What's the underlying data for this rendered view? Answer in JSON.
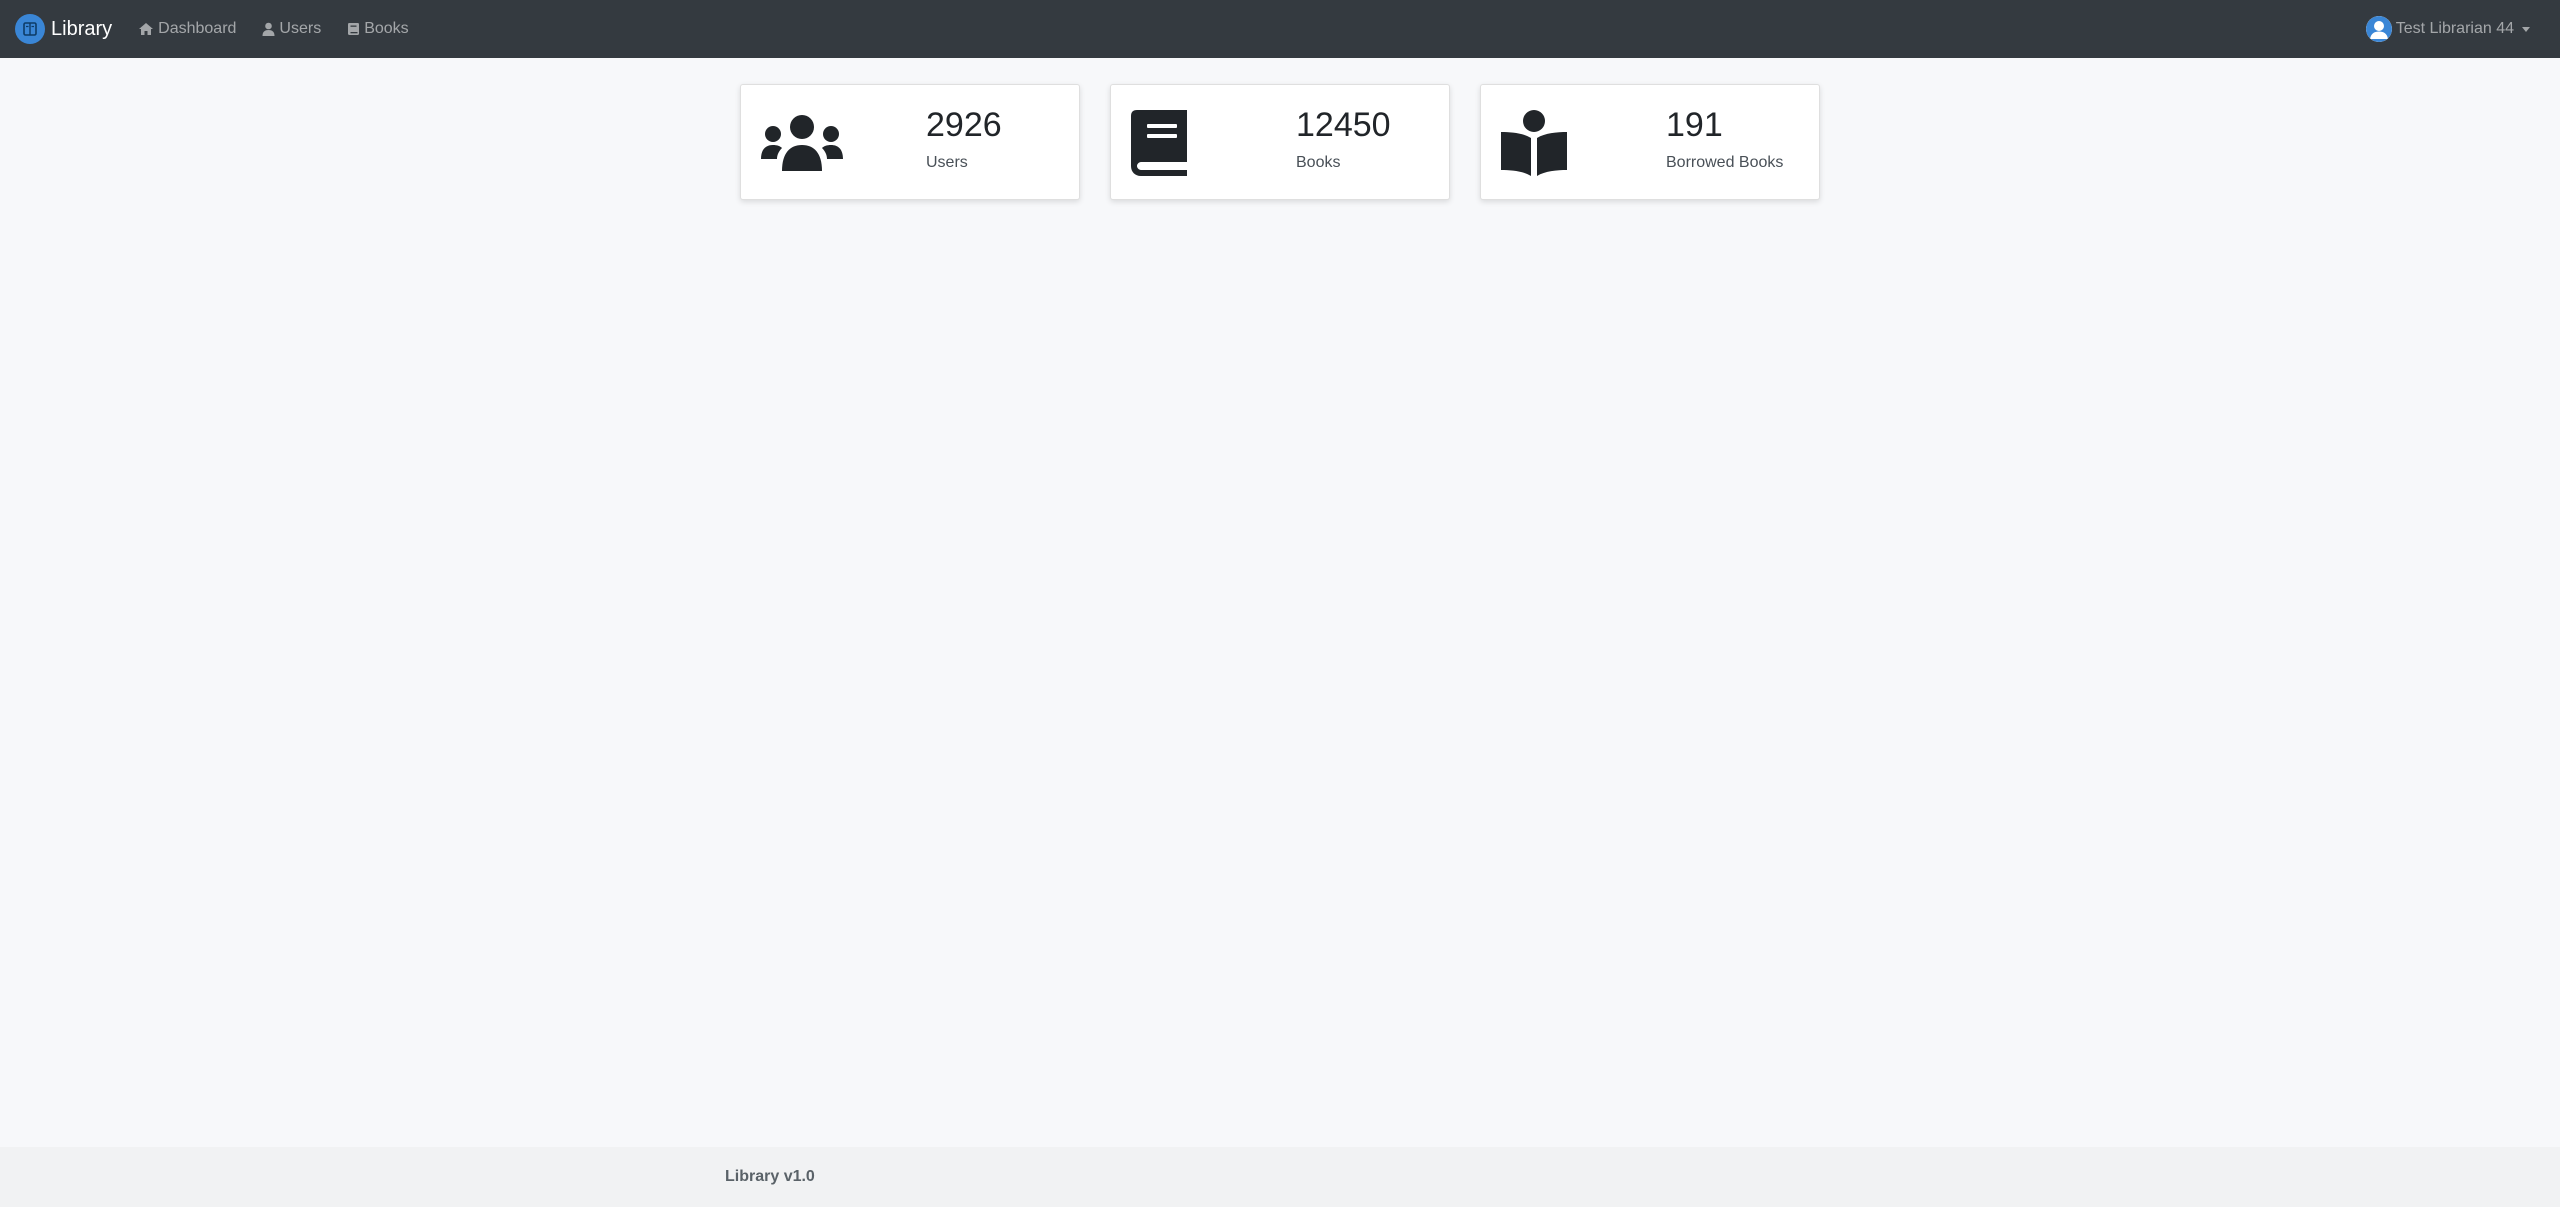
{
  "navbar": {
    "brand": "Library",
    "links": [
      {
        "label": "Dashboard",
        "icon": "home-icon"
      },
      {
        "label": "Users",
        "icon": "user-icon"
      },
      {
        "label": "Books",
        "icon": "book-icon"
      }
    ],
    "user_name": "Test Librarian 44"
  },
  "stats": [
    {
      "value": "2926",
      "label": "Users",
      "icon": "users-group-icon"
    },
    {
      "value": "12450",
      "label": "Books",
      "icon": "book-icon"
    },
    {
      "value": "191",
      "label": "Borrowed Books",
      "icon": "book-reader-icon"
    }
  ],
  "footer": {
    "text": "Library v1.0"
  },
  "colors": {
    "navbar_bg": "#343a40",
    "page_bg": "#f7f8fa",
    "brand_logo": "#3a86d6",
    "footer_bg": "#f1f2f3"
  }
}
